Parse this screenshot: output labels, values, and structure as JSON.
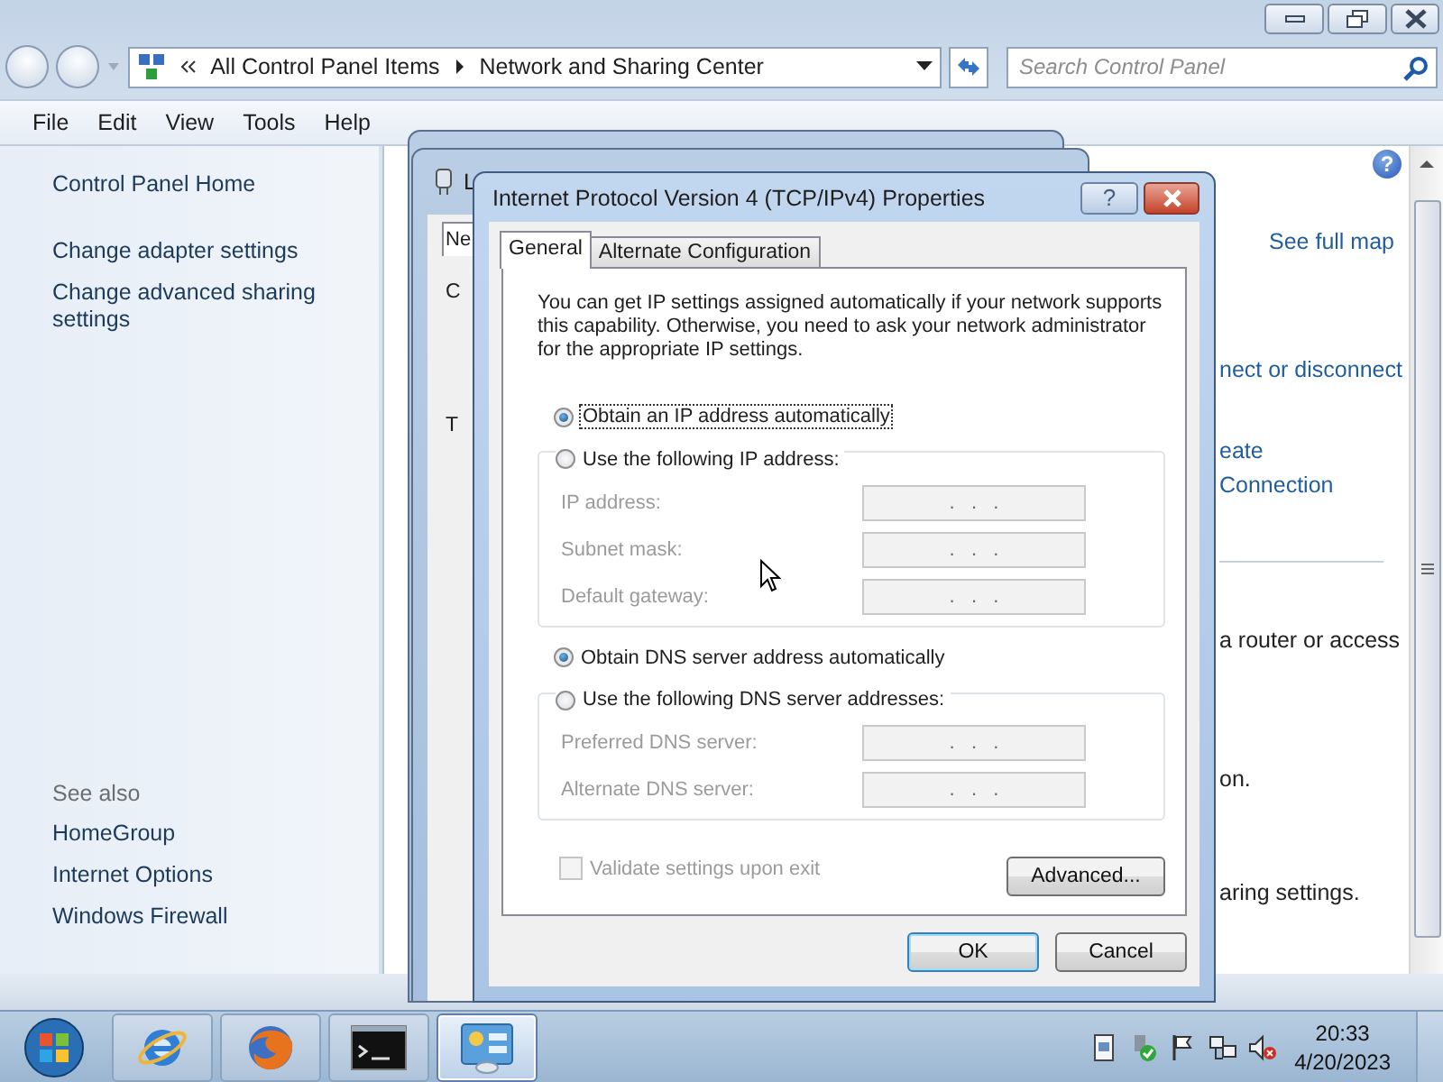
{
  "explorer": {
    "window_buttons": [
      {
        "kind": "minimize"
      },
      {
        "kind": "restore"
      },
      {
        "kind": "close"
      }
    ],
    "breadcrumb": [
      "All Control Panel Items",
      "Network and Sharing Center"
    ],
    "search": {
      "placeholder": "Search Control Panel"
    },
    "menu": [
      "File",
      "Edit",
      "View",
      "Tools",
      "Help"
    ],
    "sidebar": {
      "links": [
        "Control Panel Home",
        "Change adapter settings",
        "Change advanced sharing settings"
      ],
      "see_also_heading": "See also",
      "see_also": [
        "HomeGroup",
        "Internet Options",
        "Windows Firewall"
      ]
    },
    "help": "?",
    "content": [
      {
        "kind": "link",
        "lines": [
          "See full map"
        ]
      },
      {
        "kind": "link",
        "lines": [
          "nect or disconnect"
        ]
      },
      {
        "kind": "link",
        "lines": [
          "eate",
          "Connection"
        ]
      },
      {
        "kind": "rule"
      },
      {
        "kind": "text",
        "lines": [
          "a router or access"
        ]
      },
      {
        "kind": "text",
        "lines": [
          "on."
        ]
      },
      {
        "kind": "text",
        "lines": [
          "aring settings."
        ]
      }
    ]
  },
  "back_window": {
    "title": "L",
    "tab": "Ne",
    "labels": [
      "C",
      "T"
    ]
  },
  "dialog": {
    "title": "Internet Protocol Version 4 (TCP/IPv4) Properties",
    "help": "?",
    "tabs": [
      {
        "label": "General",
        "selected": true
      },
      {
        "label": "Alternate Configuration",
        "selected": false
      }
    ],
    "intro": "You can get IP settings assigned automatically if your network supports this capability. Otherwise, you need to ask your network administrator for the appropriate IP settings.",
    "ip_mode": [
      {
        "label": "Obtain an IP address automatically",
        "selected": true,
        "focused": true
      },
      {
        "label": "Use the following IP address:",
        "selected": false,
        "focused": false
      }
    ],
    "ip_fields": [
      {
        "label": "IP address:",
        "value": ".   .   .",
        "disabled": true
      },
      {
        "label": "Subnet mask:",
        "value": ".   .   .",
        "disabled": true
      },
      {
        "label": "Default gateway:",
        "value": ".   .   .",
        "disabled": true
      }
    ],
    "dns_mode": [
      {
        "label": "Obtain DNS server address automatically",
        "selected": true,
        "focused": false
      },
      {
        "label": "Use the following DNS server addresses:",
        "selected": false,
        "focused": false
      }
    ],
    "dns_fields": [
      {
        "label": "Preferred DNS server:",
        "value": ".   .   .",
        "disabled": true
      },
      {
        "label": "Alternate DNS server:",
        "value": ".   .   .",
        "disabled": true
      }
    ],
    "validate": {
      "label": "Validate settings upon exit",
      "checked": false,
      "disabled": true
    },
    "advanced": "Advanced...",
    "buttons": [
      {
        "label": "OK",
        "default": true
      },
      {
        "label": "Cancel",
        "default": false
      }
    ]
  },
  "taskbar": {
    "apps": [
      {
        "kind": "browser-e",
        "active": false
      },
      {
        "kind": "browser-fox",
        "active": false
      },
      {
        "kind": "terminal",
        "active": false
      },
      {
        "kind": "control-panel",
        "active": true
      }
    ],
    "tray": [
      {
        "kind": "document"
      },
      {
        "kind": "device-check"
      },
      {
        "kind": "flag"
      },
      {
        "kind": "network"
      },
      {
        "kind": "speaker-muted"
      }
    ],
    "time": "20:33",
    "date": "4/20/2023"
  }
}
